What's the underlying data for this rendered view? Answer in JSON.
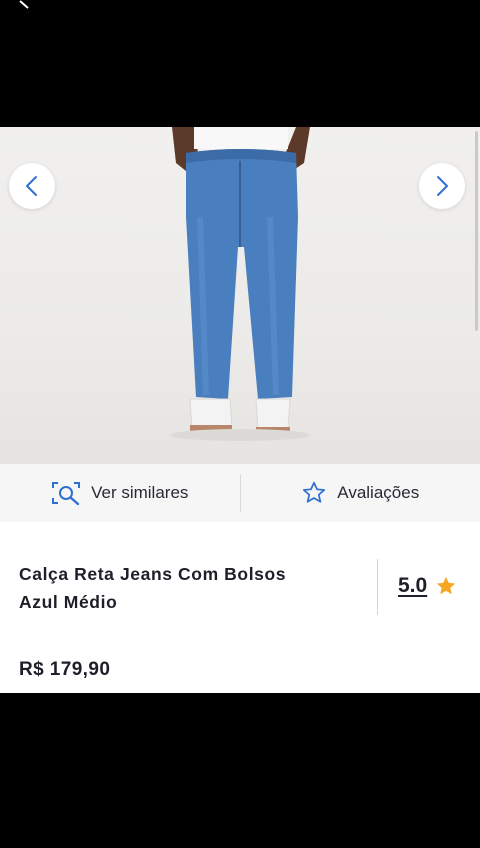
{
  "product": {
    "title_line1": "Calça Reta Jeans Com Bolsos",
    "title_line2": "Azul Médio",
    "price": "R$ 179,90",
    "rating": "5.0"
  },
  "actions": {
    "similar_label": "Ver similares",
    "reviews_label": "Avaliações"
  },
  "colors": {
    "accent_blue": "#2f6fd0",
    "star": "#f5a623",
    "text": "#1f1f29"
  },
  "icons": {
    "prev": "chevron-left-icon",
    "next": "chevron-right-icon",
    "similar": "visual-search-icon",
    "reviews": "star-outline-icon",
    "rating_star": "star-filled-icon"
  }
}
